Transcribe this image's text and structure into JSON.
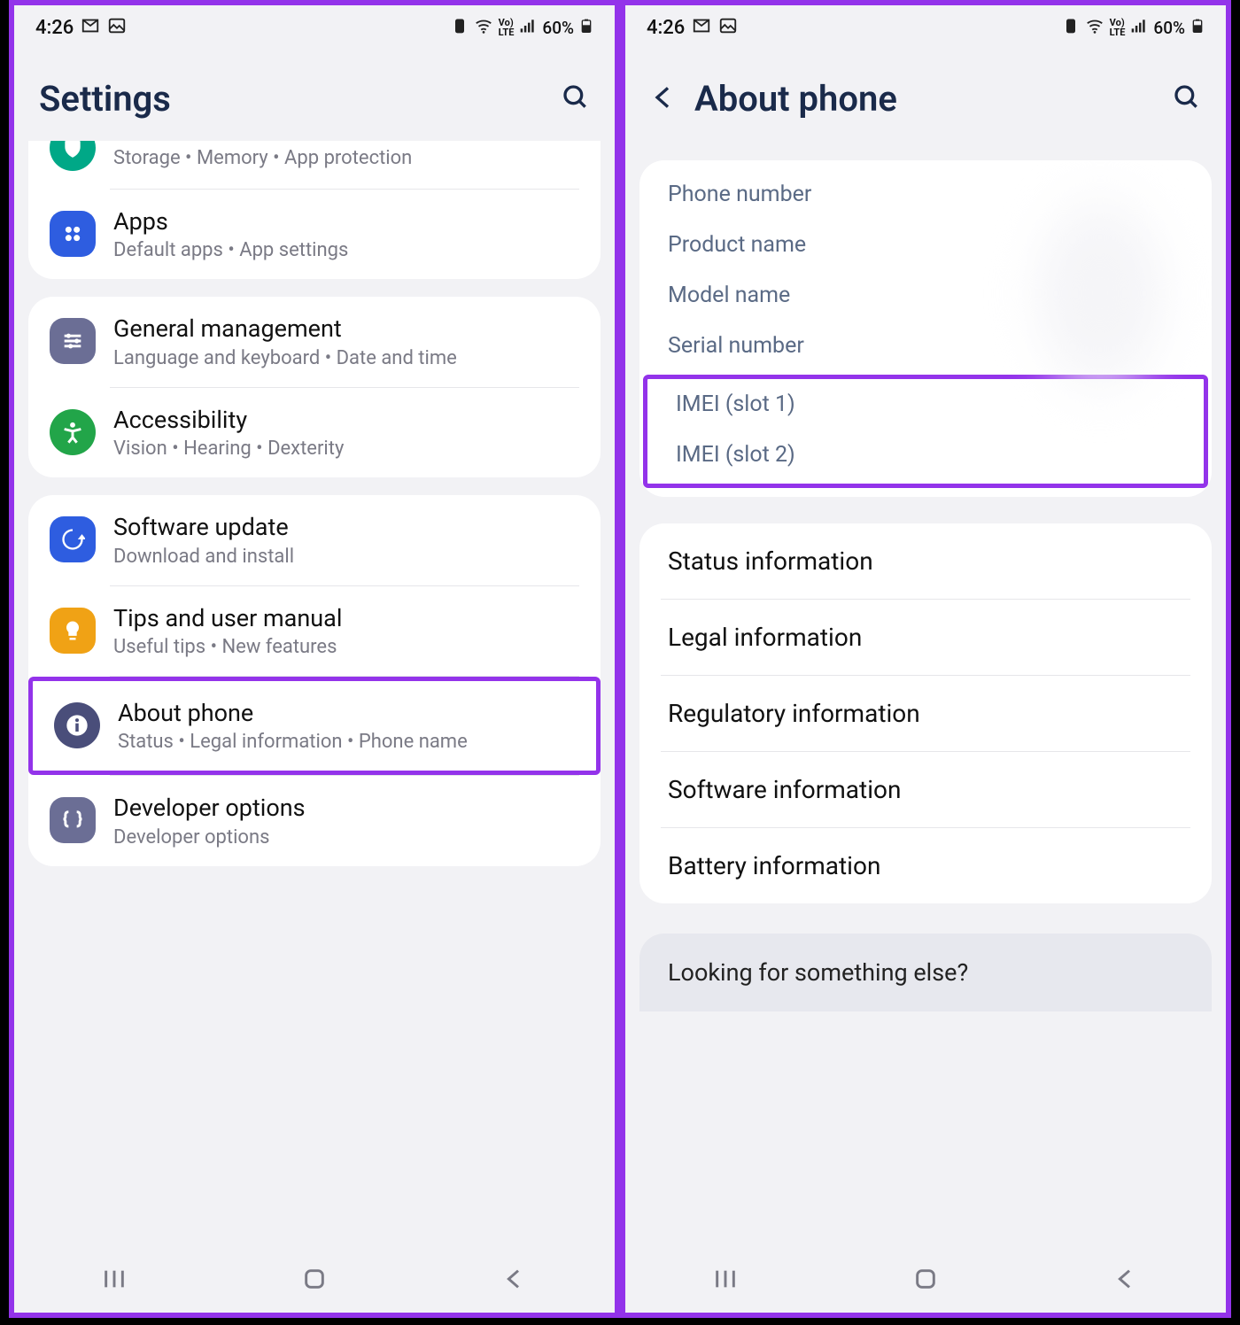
{
  "status": {
    "time": "4:26",
    "battery": "60%",
    "lte": "LTE"
  },
  "left": {
    "title": "Settings",
    "top_sub": "Storage  •  Memory  •  App protection",
    "items": [
      {
        "title": "Apps",
        "sub": "Default apps  •  App settings",
        "color": "#2e5de0"
      },
      {
        "title": "General management",
        "sub": "Language and keyboard  •  Date and time",
        "color": "#6b6e95"
      },
      {
        "title": "Accessibility",
        "sub": "Vision  •  Hearing  •  Dexterity",
        "color": "#22a549"
      },
      {
        "title": "Software update",
        "sub": "Download and install",
        "color": "#2e5de0"
      },
      {
        "title": "Tips and user manual",
        "sub": "Useful tips  •  New features",
        "color": "#f0a215"
      },
      {
        "title": "About phone",
        "sub": "Status  •  Legal information  •  Phone name",
        "color": "#4a4e7a"
      },
      {
        "title": "Developer options",
        "sub": "Developer options",
        "color": "#6b6e95"
      }
    ]
  },
  "right": {
    "title": "About phone",
    "info": {
      "phone_number": "Phone number",
      "product_name": "Product name",
      "model_name": "Model name",
      "serial_number": "Serial number",
      "imei1": "IMEI (slot 1)",
      "imei2": "IMEI (slot 2)"
    },
    "list": [
      "Status information",
      "Legal information",
      "Regulatory information",
      "Software information",
      "Battery information"
    ],
    "footer": "Looking for something else?"
  }
}
